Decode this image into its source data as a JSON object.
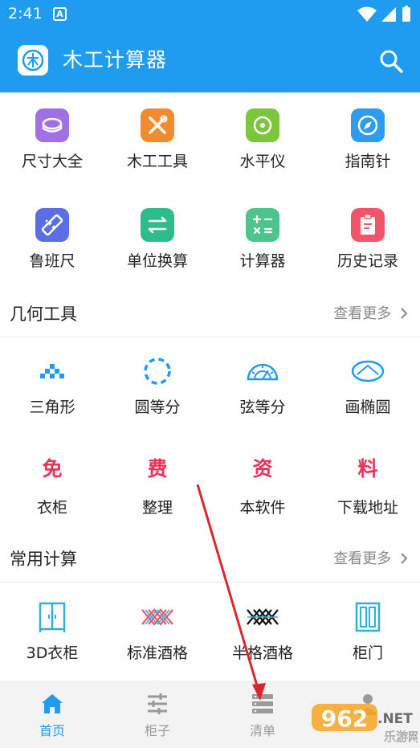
{
  "status_bar": {
    "time": "2:41",
    "notification_letter": "A"
  },
  "app_bar": {
    "title": "木工计算器"
  },
  "tools": [
    {
      "label": "尺寸大全",
      "icon": "ruler-tape-icon",
      "color": "#a070e6"
    },
    {
      "label": "木工工具",
      "icon": "tools-icon",
      "color": "#f28a2e"
    },
    {
      "label": "水平仪",
      "icon": "level-icon",
      "color": "#7cc63c"
    },
    {
      "label": "指南针",
      "icon": "compass-icon",
      "color": "#2e9af0"
    },
    {
      "label": "鲁班尺",
      "icon": "ruler-icon",
      "color": "#5a6fe6"
    },
    {
      "label": "单位换算",
      "icon": "exchange-icon",
      "color": "#2ebc8c"
    },
    {
      "label": "计算器",
      "icon": "calculator-icon",
      "color": "#4cc48a"
    },
    {
      "label": "历史记录",
      "icon": "clipboard-icon",
      "color": "#f0566a"
    }
  ],
  "geometry_section": {
    "title": "几何工具",
    "more": "查看更多",
    "items": [
      {
        "label": "三角形",
        "icon": "triangle-icon"
      },
      {
        "label": "圆等分",
        "icon": "dashed-circle-icon"
      },
      {
        "label": "弦等分",
        "icon": "protractor-icon"
      },
      {
        "label": "画椭圆",
        "icon": "ellipse-icon"
      },
      {
        "label": "衣柜",
        "char": "免"
      },
      {
        "label": "整理",
        "char": "费"
      },
      {
        "label": "本软件",
        "char": "资"
      },
      {
        "label": "下载地址",
        "char": "料"
      }
    ]
  },
  "common_section": {
    "title": "常用计算",
    "more": "查看更多",
    "items": [
      {
        "label": "3D衣柜",
        "icon": "wardrobe-icon"
      },
      {
        "label": "标准酒格",
        "icon": "wine-rack-icon"
      },
      {
        "label": "半格酒格",
        "icon": "half-wine-rack-icon"
      },
      {
        "label": "柜门",
        "icon": "cabinet-door-icon"
      }
    ]
  },
  "tab_bar": {
    "tabs": [
      {
        "label": "首页",
        "icon": "home-icon",
        "active": true
      },
      {
        "label": "柜子",
        "icon": "sliders-icon",
        "active": false
      },
      {
        "label": "清单",
        "icon": "list-icon",
        "active": false
      },
      {
        "label": "",
        "icon": "profile-icon",
        "active": false
      }
    ]
  },
  "watermark": {
    "brand_number": "962",
    "brand_suffix": ".NET",
    "brand_name": "乐游网"
  },
  "colors": {
    "primary": "#1f9cf0",
    "accent_red": "#e8335a",
    "arrow": "#d8282e"
  }
}
